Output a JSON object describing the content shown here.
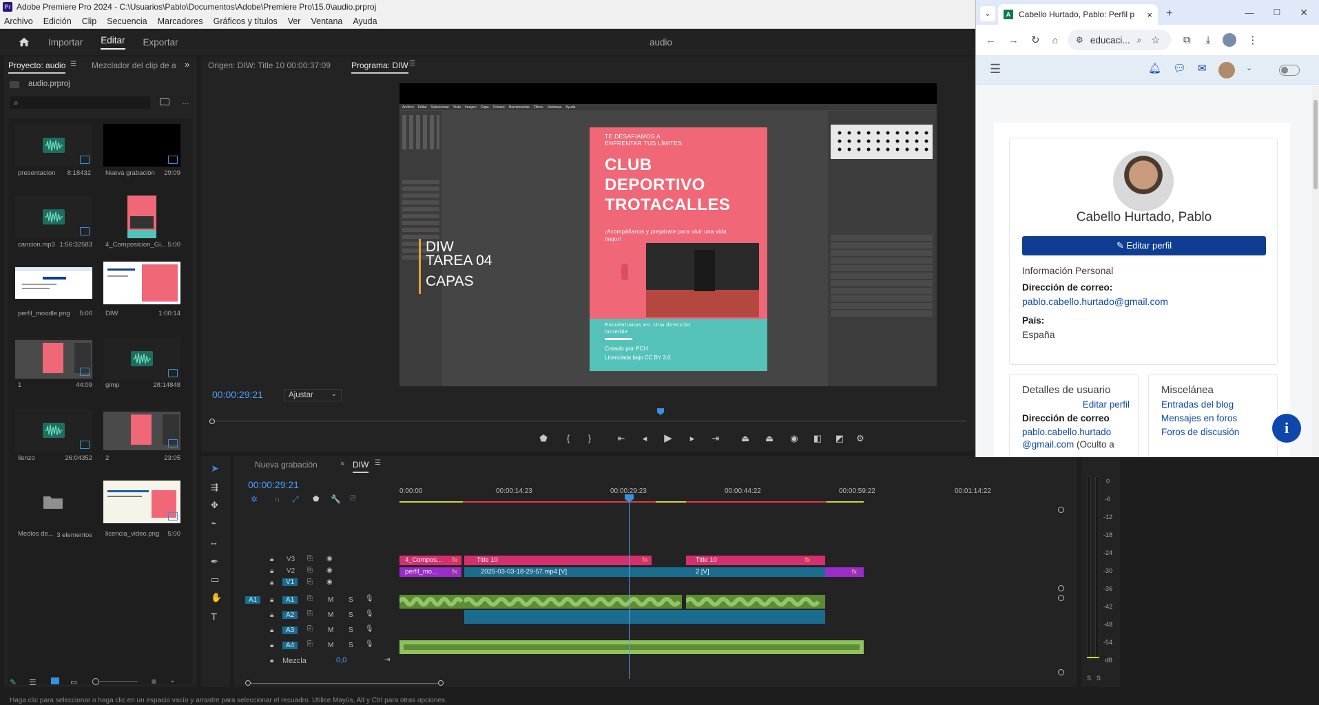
{
  "window": {
    "title": "Adobe Premiere Pro 2024 - C:\\Usuarios\\Pablo\\Documentos\\Adobe\\Premiere Pro\\15.0\\audio.prproj",
    "logo_text": "Pr"
  },
  "menu": [
    "Archivo",
    "Edición",
    "Clip",
    "Secuencia",
    "Marcadores",
    "Gráficos y títulos",
    "Ver",
    "Ventana",
    "Ayuda"
  ],
  "workspace": {
    "tabs": [
      "Importar",
      "Editar",
      "Exportar"
    ],
    "active": "Editar",
    "project_name": "audio"
  },
  "project_panel": {
    "tab_label": "Proyecto: audio",
    "tab2_label": "Mezclador del clip de a",
    "file": "audio.prproj",
    "items": [
      {
        "name": "presentacion",
        "duration": "8:18432",
        "kind": "audio"
      },
      {
        "name": "Nueva grabación",
        "duration": "29:09",
        "kind": "black"
      },
      {
        "name": "cancion.mp3",
        "duration": "1:56:32583",
        "kind": "audio"
      },
      {
        "name": "4_Composicion_Gi...",
        "duration": "5:00",
        "kind": "poster"
      },
      {
        "name": "perfil_moodle.png",
        "duration": "5:00",
        "kind": "moodle"
      },
      {
        "name": "DIW",
        "duration": "1:00:14",
        "kind": "diw"
      },
      {
        "name": "1",
        "duration": "44:09",
        "kind": "gimp"
      },
      {
        "name": "gimp",
        "duration": "28:14848",
        "kind": "audio"
      },
      {
        "name": "lienzo",
        "duration": "26:04352",
        "kind": "audio"
      },
      {
        "name": "2",
        "duration": "23:05",
        "kind": "gimp"
      },
      {
        "name": "Medios de...",
        "duration": "3 elementos",
        "kind": "folder"
      },
      {
        "name": "licencia_video.png",
        "duration": "5:00",
        "kind": "licencia"
      }
    ]
  },
  "source_monitor": {
    "label": "Origen: DIW: Title 10 00:00:37:09"
  },
  "program_monitor": {
    "label": "Programa: DIW",
    "timecode": "00:00:29:21",
    "fit": "Ajustar",
    "frame": {
      "gimp_menu": [
        "Archivo",
        "Editar",
        "Seleccionar",
        "Vista",
        "Imagen",
        "Capa",
        "Colores",
        "Herramientas",
        "Filtros",
        "Ventanas",
        "Ayuda"
      ],
      "poster": {
        "challenge": "TE DESAFIAMOS A\nENFRENTAR TUS LÍMITES",
        "title_lines": [
          "CLUB",
          "DEPORTIVO",
          "TROTACALLES"
        ],
        "subtitle": "¡Acompáñanos y prepárate para vivir una vida mejor!",
        "find_us": "Encuéntranos en: Una dirección increíble",
        "credit1": "Creado por PCH",
        "credit2": "Licenciada bajo CC BY 3.0."
      },
      "overlay": {
        "line1": "DIW",
        "line2": "TAREA 04",
        "line3": "CAPAS"
      }
    }
  },
  "timeline": {
    "tabs": [
      "Nueva grabación",
      "DIW"
    ],
    "active_tab": "DIW",
    "timecode": "00:00:29:21",
    "ruler": [
      "0:00:00",
      "00:00:14:23",
      "00:00:29:23",
      "00:00:44:22",
      "00:00:59:22",
      "00:01:14:22"
    ],
    "tracks": [
      {
        "id": "V3",
        "kind": "video"
      },
      {
        "id": "V2",
        "kind": "video"
      },
      {
        "id": "V1",
        "kind": "video"
      },
      {
        "id": "A1",
        "kind": "audio",
        "src": "A1"
      },
      {
        "id": "A2",
        "kind": "audio"
      },
      {
        "id": "A3",
        "kind": "audio"
      },
      {
        "id": "A4",
        "kind": "audio"
      }
    ],
    "mix_label": "Mezcla",
    "mix_value": "0,0",
    "clips": {
      "v3_a": "4_Compos...",
      "v3_b": "Title 10",
      "v3_c": "Title 10",
      "v2_a": "perfil_mo...",
      "v2_b": "2025-03-03-18-29-57.mp4 [V]",
      "v2_c": "2 [V]",
      "fx": "fx"
    },
    "audio_buttons": {
      "mute": "M",
      "solo": "S"
    }
  },
  "vu_meter": {
    "scale": [
      "0",
      "-6",
      "-12",
      "-18",
      "-24",
      "-30",
      "-36",
      "-42",
      "-48",
      "-54",
      "dB"
    ],
    "solo": [
      "S",
      "S"
    ]
  },
  "status": "Haga clic para seleccionar o haga clic en un espacio vacío y arrastre para seleccionar el recuadro. Utilice Mayús, Alt y Ctrl para otras opciones.",
  "browser": {
    "tab_title": "Cabello Hurtado, Pablo: Perfil p",
    "address": "educaci...",
    "profile": {
      "name": "Cabello Hurtado, Pablo",
      "edit_button": "Editar perfil",
      "section_personal": "Información Personal",
      "email_label": "Dirección de correo:",
      "email": "pablo.cabello.hurtado@gmail.com",
      "country_label": "País:",
      "country": "España",
      "details_title": "Detalles de usuario",
      "details_edit": "Editar perfil",
      "details_email_label": "Dirección de correo",
      "details_email_1": "pablo.cabello.hurtado",
      "details_email_2": "@gmail.com",
      "details_hidden": "(Oculto a",
      "misc_title": "Miscelánea",
      "misc_links": [
        "Entradas del blog",
        "Mensajes en foros",
        "Foros de discusión"
      ]
    }
  },
  "colors": {
    "premiere_bg": "#1d1d1d",
    "panel": "#232323",
    "timecode_blue": "#4aa0ff",
    "clip_pink": "#d4306f",
    "clip_purple": "#9a2cc9",
    "clip_teal": "#1b6d8f",
    "audio_green": "#6aa83c",
    "poster_coral": "#f06777",
    "poster_teal": "#55c2ba",
    "moodle_blue": "#0f3d91"
  }
}
